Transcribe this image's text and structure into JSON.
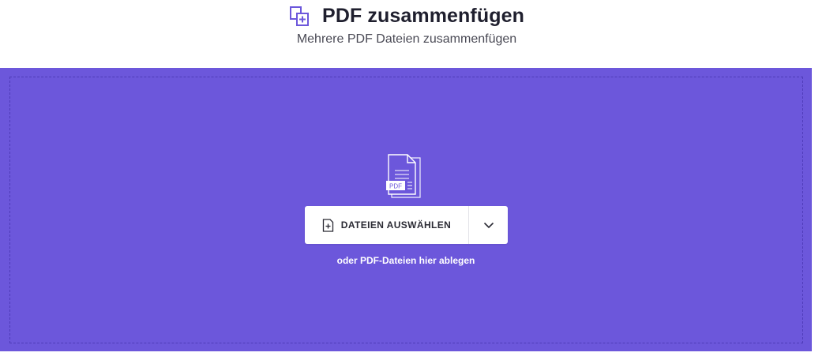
{
  "header": {
    "title": "PDF zusammenfügen",
    "subtitle": "Mehrere PDF Dateien zusammenfügen",
    "icon": "merge-files-icon"
  },
  "dropzone": {
    "illustration_icon": "pdf-files-icon",
    "illustration_label": "PDF",
    "select_button_label": "DATEIEN AUSWÄHLEN",
    "select_button_icon": "add-file-icon",
    "toggle_icon": "chevron-down-icon",
    "hint": "oder PDF-Dateien hier ablegen"
  },
  "colors": {
    "accent": "#6c57db",
    "accent_dark": "#4e3bb8",
    "title_text": "#1f1f2e",
    "subtitle_text": "#4a4a55"
  }
}
